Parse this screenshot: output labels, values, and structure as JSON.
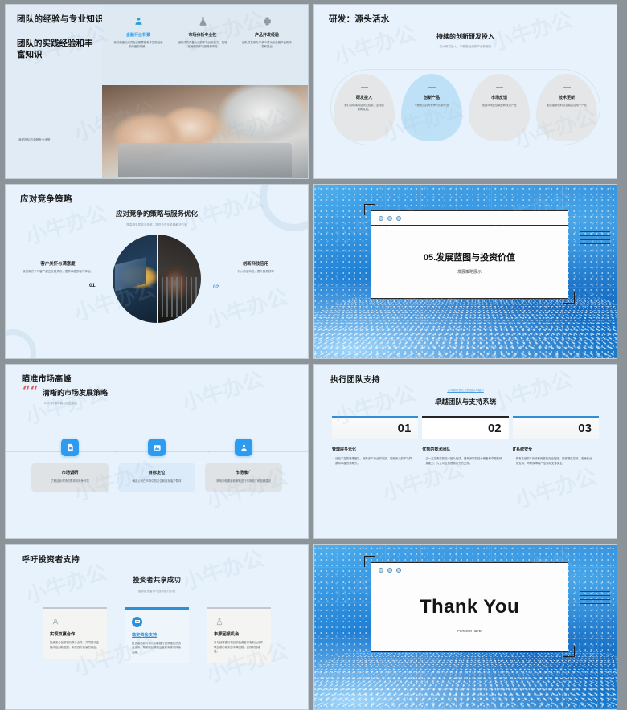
{
  "slides": {
    "s1": {
      "title": "团队的经验与专业知识",
      "subtitle": "团队的实践经验和丰富知识",
      "caption": "我们团队的金融专业优势",
      "columns": [
        {
          "icon": "user-icon",
          "glyph": "⚫",
          "title": "金融行业背景",
          "body": "我们的团队成员在金融界拥有丰富的经验和深度的理解。"
        },
        {
          "icon": "flask-icon",
          "glyph": "⚫",
          "title": "市场分析专业性",
          "body": "团队成员具备九流的市场分析能力，能够准确预测市场趋势和风险"
        },
        {
          "icon": "product-icon",
          "glyph": "⚫",
          "title": "产品开发经验",
          "body": "团队成员参与12多个成功的金融产品的研发和推出"
        }
      ]
    },
    "s2": {
      "title": "研发：源头活水",
      "center_title": "持续的创新研发投入",
      "center_sub": "加大研发投入，不断推出创新产品和服务",
      "blobs": [
        {
          "title": "研发投入",
          "body": "我们将继续增加研发经费，支持创新和发展。",
          "highlight": false
        },
        {
          "title": "创新产品",
          "body": "不断推出具有竞争力的新产品",
          "highlight": true
        },
        {
          "title": "市场反馈",
          "body": "根据市场反馈调整和改进产品",
          "highlight": false
        },
        {
          "title": "技术更新",
          "body": "跟进最新的科技发展并应用于产品",
          "highlight": false
        }
      ]
    },
    "s3": {
      "title": "应对竞争策略",
      "center_title": "应对竞争的策略与服务优化",
      "center_sub": "提高服务质量与效率，提供个性化金融解决方案",
      "left": {
        "num": "01.",
        "title": "客户关怀与满意度",
        "body": "我们致力于与客户建立长期关系，提供卓越的客户体验。"
      },
      "right": {
        "num": "02.",
        "title": "创新科技应用",
        "body": "引入前沿科技，提升服务效率"
      }
    },
    "s4": {
      "title": "05.发展蓝图与投资价值",
      "subtitle": "发展策略展示"
    },
    "s5": {
      "title": "瞄准市场高峰",
      "quote_mark": "““",
      "headline": "清晰的市场发展策略",
      "sub": "4317 片面标题与描述制定",
      "steps": [
        {
          "icon": "document-icon",
          "glyph": "Ὄ4",
          "title": "市场调研",
          "body": "了解目标市场的需求和竞争环境",
          "highlight": false
        },
        {
          "icon": "image-target-icon",
          "glyph": "ὛC",
          "title": "目标定位",
          "body": "确定公司在市场中的定位和目标客户群体",
          "highlight": true
        },
        {
          "icon": "person-icon",
          "glyph": "὆4",
          "title": "市场推广",
          "body": "采用多种渠道和策略进行市场推广和品牌建设",
          "highlight": false
        }
      ]
    },
    "s6": {
      "title": "执行团队支持",
      "kicker": "公司拥有多元化的团队与组织",
      "center_title": "卓越团队与支持系统",
      "cards": [
        {
          "num": "01",
          "title": "管理层多元化",
          "body": "经验丰富的管理团队，拥有多个行业的背景，能够深入的市场洞察和卓越的领导力。",
          "dark": false
        },
        {
          "num": "02",
          "title": "优秀的技术团队",
          "body": "由一支高素质的技术团队组成，拥有深厚的技术储备和卓越的研发能力，为公司业务提供有力的支撑。",
          "dark": true
        },
        {
          "num": "03",
          "title": "IT系统安全",
          "body": "拥有先进的IT系统和完善的安全措施，能够提供高效、准确的业务支持，同时保障客户信息和交易安全。",
          "dark": false
        }
      ]
    },
    "s7": {
      "title": "呼吁投资者支持",
      "center_title": "投资者共享成功",
      "center_sub": "邀请投资者参与创新银行项目",
      "cards": [
        {
          "icon": "handshake-icon",
          "glyph": "⚙",
          "title": "实现双赢合作",
          "body": "投资者与创新银行携手合作，共同推动金融科技创新发展，实现双方共赢的局面。",
          "highlight": false
        },
        {
          "icon": "money-icon",
          "glyph": "▤",
          "title": "稳定资金支持",
          "body": "投资者的参与将为创新银行提供稳定的资金支持，帮助项目顺利运营并实现可持续发展。",
          "highlight": true
        },
        {
          "icon": "flask-icon",
          "glyph": "⚗",
          "title": "丰厚回报机会",
          "body": "参与创新银行项目的投资者将有机会分享项目成功带来的丰厚回报，实现财富增值。",
          "highlight": false
        }
      ]
    },
    "s8": {
      "thanks": "Thank You",
      "presenter": "Presenter name"
    }
  },
  "watermark": "小牛办公",
  "colors": {
    "accent": "#2f8fd6",
    "slide_bg": "#e7f2fc",
    "deck_bg": "#8d9499",
    "dark_accent": "#22262b"
  }
}
